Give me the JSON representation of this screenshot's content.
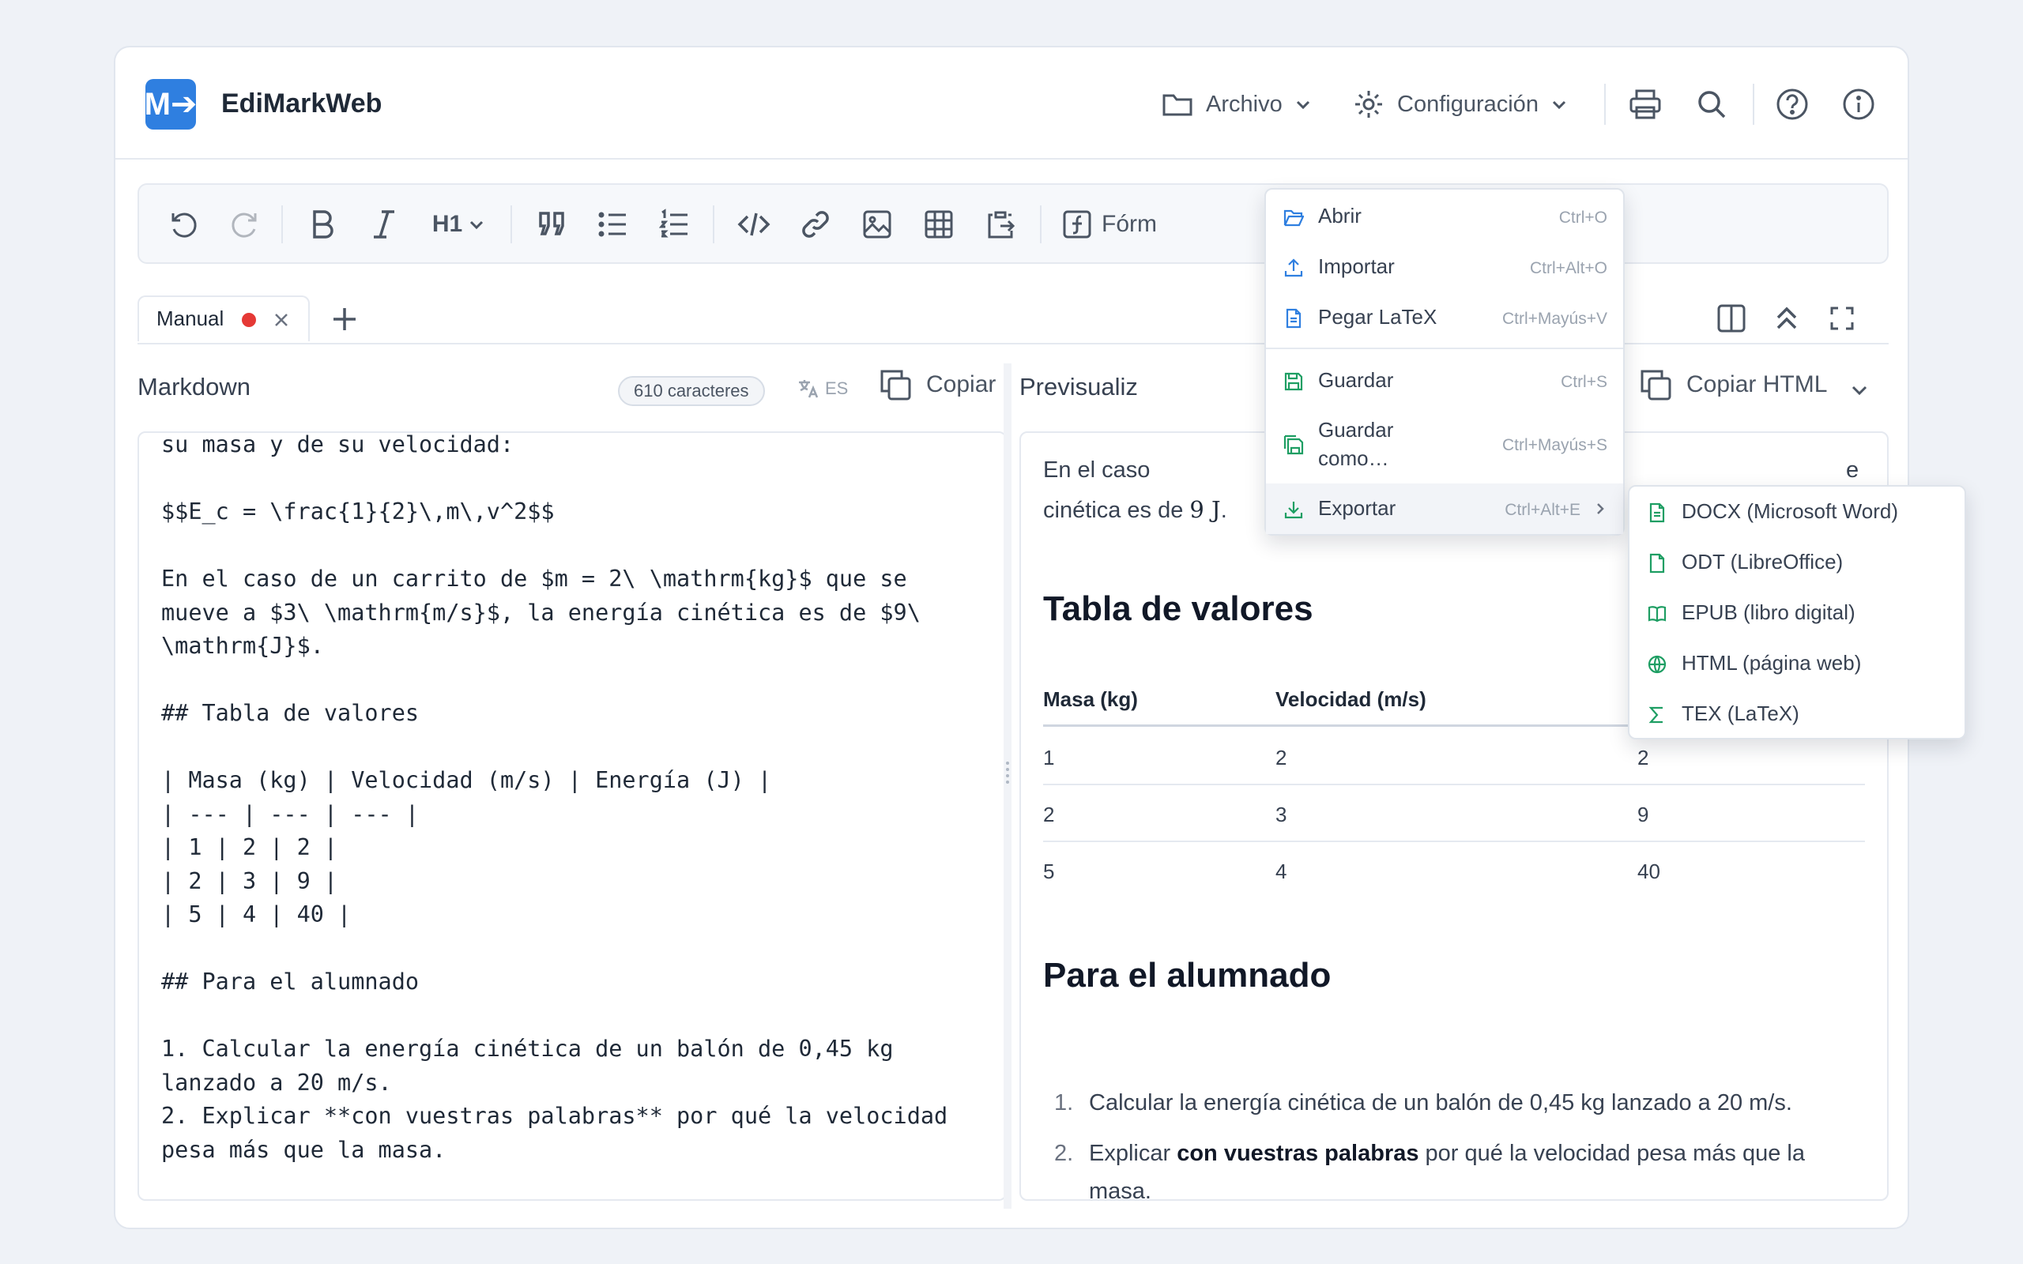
{
  "app": {
    "logo": "M➔",
    "title": "EdiMarkWeb"
  },
  "topbar": {
    "archivo": "Archivo",
    "configuracion": "Configuración",
    "icons": [
      "folder-icon",
      "gear-icon",
      "printer-icon",
      "search-icon",
      "help-icon",
      "info-icon"
    ]
  },
  "toolbar": {
    "heading": "H1",
    "formula": "Fórm"
  },
  "tabs": [
    {
      "label": "Manual"
    }
  ],
  "editor_pane": {
    "title": "Markdown",
    "char_count": "610 caracteres",
    "lang": "ES",
    "copy": "Copiar",
    "text": "su masa y de su velocidad:\n\n$$E_c = \\frac{1}{2}\\,m\\,v^2$$\n\nEn el caso de un carrito de $m = 2\\ \\mathrm{kg}$ que se\nmueve a $3\\ \\mathrm{m/s}$, la energía cinética es de $9\\\n\\mathrm{J}$.\n\n## Tabla de valores\n\n| Masa (kg) | Velocidad (m/s) | Energía (J) |\n| --- | --- | --- |\n| 1 | 2 | 2 |\n| 2 | 3 | 9 |\n| 5 | 4 | 40 |\n\n## Para el alumnado\n\n1. Calcular la energía cinética de un balón de 0,45 kg\nlanzado a 20 m/s.\n2. Explicar **con vuestras palabras** por qué la velocidad\npesa más que la masa."
  },
  "preview_pane": {
    "title": "Previsualiz",
    "copy_html": "Copiar HTML",
    "intro_1": "En el caso",
    "intro_1_tail": "e",
    "intro_2_pre": "cinética es de ",
    "intro_2_math": "9 J",
    "intro_2_post": ".",
    "h2_table": "Tabla de valores",
    "table_headers": [
      "Masa (kg)",
      "Velocidad (m/s)",
      ""
    ],
    "table_rows": [
      [
        "1",
        "2",
        "2"
      ],
      [
        "2",
        "3",
        "9"
      ],
      [
        "5",
        "4",
        "40"
      ]
    ],
    "h2_students": "Para el alumnado",
    "list": {
      "item1_num": "1.",
      "item1": "Calcular la energía cinética de un balón de 0,45 kg lanzado a 20 m/s.",
      "item2_num": "2.",
      "item2_pre": "Explicar ",
      "item2_bold": "con vuestras palabras",
      "item2_post": " por qué la velocidad pesa más que la masa."
    }
  },
  "archivo_menu": {
    "items": [
      {
        "label": "Abrir",
        "shortcut": "Ctrl+O"
      },
      {
        "label": "Importar",
        "shortcut": "Ctrl+Alt+O"
      },
      {
        "label": "Pegar LaTeX",
        "shortcut": "Ctrl+Mayús+V"
      },
      {
        "label": "Guardar",
        "shortcut": "Ctrl+S"
      },
      {
        "label": "Guardar como…",
        "label_line1": "Guardar",
        "label_line2": "como…",
        "shortcut": "Ctrl+Mayús+S"
      },
      {
        "label": "Exportar",
        "shortcut": "Ctrl+Alt+E"
      }
    ]
  },
  "export_submenu": {
    "items": [
      {
        "label": "DOCX (Microsoft Word)"
      },
      {
        "label": "ODT (LibreOffice)"
      },
      {
        "label": "EPUB (libro digital)"
      },
      {
        "label": "HTML (página web)"
      },
      {
        "label": "TEX (LaTeX)"
      }
    ]
  },
  "colors": {
    "accent": "#2f7fe0",
    "menu_icon_blue": "#2f7fe0",
    "menu_icon_green": "#1e9e63",
    "unsaved_dot": "#e53935"
  }
}
